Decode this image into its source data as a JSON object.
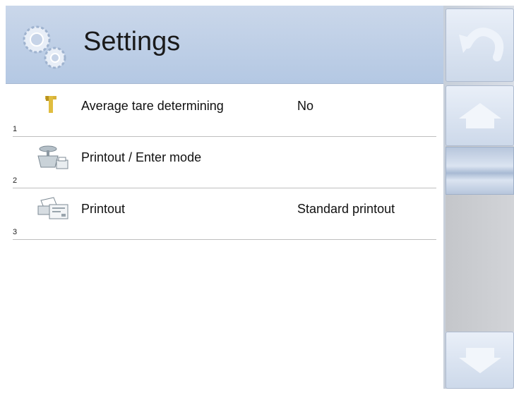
{
  "header": {
    "title": "Settings",
    "icon": "gears-icon"
  },
  "items": [
    {
      "number": "1",
      "label": "Average tare determining",
      "value": "No",
      "icon": "tare-icon"
    },
    {
      "number": "2",
      "label": "Printout / Enter mode",
      "value": "",
      "icon": "scale-printer-icon"
    },
    {
      "number": "3",
      "label": "Printout",
      "value": "Standard printout",
      "icon": "printer-icon"
    }
  ],
  "controls": {
    "back": "back-arrow-icon",
    "up": "arrow-up-icon",
    "down": "arrow-down-icon"
  },
  "colors": {
    "header_bg": "#b4c8e3",
    "button_bg": "#cdd9ea",
    "divider": "#bfbfbf"
  }
}
